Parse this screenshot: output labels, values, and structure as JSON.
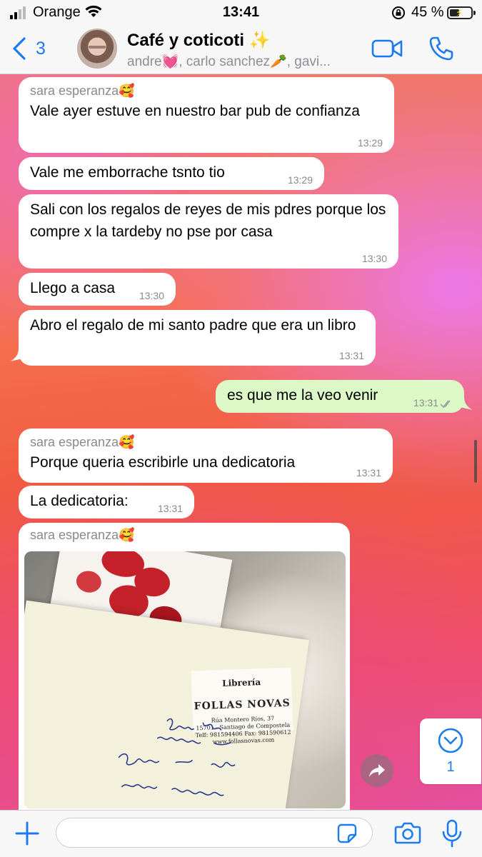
{
  "status_bar": {
    "carrier": "Orange",
    "time": "13:41",
    "battery_percent": "45 %",
    "battery_level": 0.45
  },
  "header": {
    "back_count": "3",
    "chat_title": "Café y coticoti ✨",
    "members": "andre💓, carlo sanchez🥕, gavi..."
  },
  "messages": [
    {
      "direction": "in",
      "sender": "sara esperanza🥰",
      "text": "Vale ayer estuve en nuestro bar pub de confianza",
      "time": "13:29"
    },
    {
      "direction": "in",
      "text": "Vale me emborrache tsnto tio",
      "time": "13:29"
    },
    {
      "direction": "in",
      "text": "Sali con los regalos de reyes de mis pdres porque los compre x la tardeby no pse por casa",
      "time": "13:30"
    },
    {
      "direction": "in",
      "text": "Llego a casa",
      "time": "13:30"
    },
    {
      "direction": "in",
      "text": "Abro el regalo de mi santo padre que era un libro",
      "time": "13:31"
    },
    {
      "direction": "out",
      "text": "es que me la veo venir",
      "time": "13:31",
      "status": "delivered"
    },
    {
      "direction": "in",
      "sender": "sara esperanza🥰",
      "text": "Porque queria escribirle una dedicatoria",
      "time": "13:31"
    },
    {
      "direction": "in",
      "text": "La dedicatoria:",
      "time": "13:31"
    },
    {
      "direction": "in",
      "sender": "sara esperanza🥰",
      "type": "image",
      "photo_text": {
        "store": "Librería",
        "brand": "FOLLAS NOVAS",
        "address": "Rúa Montero Ríos, 37",
        "city": "15701 - Santiago de Compostela",
        "phone": "Telf: 981594406  Fax: 981590612",
        "web": "www.follasnovas.com"
      }
    }
  ],
  "unread": {
    "count": "1"
  },
  "composer": {
    "placeholder": ""
  },
  "icons": {
    "back": "chevron-left-icon",
    "video": "video-camera-icon",
    "call": "phone-icon",
    "plus": "plus-icon",
    "sticker": "sticker-icon",
    "camera": "camera-icon",
    "mic": "microphone-icon",
    "forward": "forward-icon",
    "scroll_down": "chevron-down-circle-icon"
  },
  "colors": {
    "accent": "#1d7bf0",
    "outgoing_bubble": "#dcf8c6",
    "incoming_bubble": "#ffffff"
  }
}
